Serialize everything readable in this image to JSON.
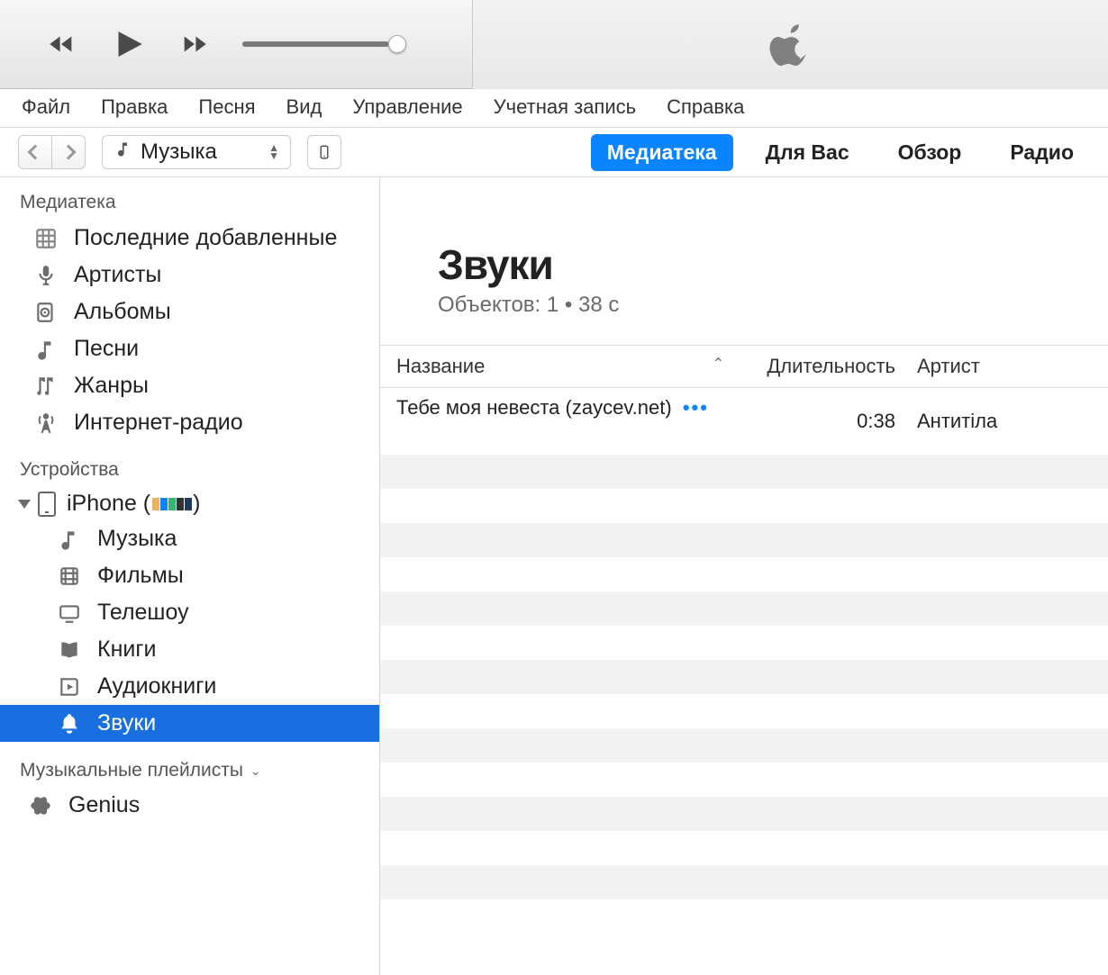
{
  "menu": {
    "items": [
      "Файл",
      "Правка",
      "Песня",
      "Вид",
      "Управление",
      "Учетная запись",
      "Справка"
    ]
  },
  "toolbar": {
    "category_label": "Музыка",
    "tabs": [
      "Медиатека",
      "Для Вас",
      "Обзор",
      "Радио"
    ],
    "active_tab_index": 0
  },
  "sidebar": {
    "library_head": "Медиатека",
    "library_items": [
      {
        "label": "Последние добавленные",
        "icon": "grid"
      },
      {
        "label": "Артисты",
        "icon": "mic"
      },
      {
        "label": "Альбомы",
        "icon": "album"
      },
      {
        "label": "Песни",
        "icon": "note"
      },
      {
        "label": "Жанры",
        "icon": "genre"
      },
      {
        "label": "Интернет-радио",
        "icon": "radio"
      }
    ],
    "devices_head": "Устройства",
    "device_name": "iPhone",
    "device_items": [
      {
        "label": "Музыка",
        "icon": "note"
      },
      {
        "label": "Фильмы",
        "icon": "film"
      },
      {
        "label": "Телешоу",
        "icon": "tv"
      },
      {
        "label": "Книги",
        "icon": "book"
      },
      {
        "label": "Аудиокниги",
        "icon": "abook"
      },
      {
        "label": "Звуки",
        "icon": "bell",
        "selected": true
      }
    ],
    "playlists_head": "Музыкальные плейлисты",
    "playlists": [
      {
        "label": "Genius",
        "icon": "atom"
      }
    ]
  },
  "content": {
    "title": "Звуки",
    "subtitle": "Объектов: 1 • 38 с",
    "columns": {
      "title": "Название",
      "duration": "Длительность",
      "artist": "Артист"
    },
    "rows": [
      {
        "title": "Тебе моя невеста (zaycev.net)",
        "duration": "0:38",
        "artist": "Антитіла"
      }
    ]
  }
}
